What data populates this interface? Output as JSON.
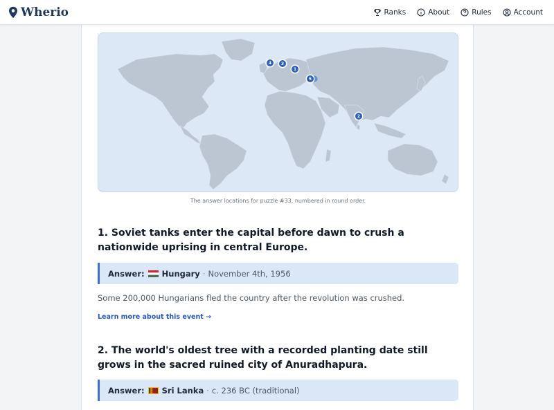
{
  "app": {
    "brand": "Wherio"
  },
  "nav": {
    "ranks": "Ranks",
    "about": "About",
    "rules": "Rules",
    "account": "Account"
  },
  "map": {
    "caption": "The answer locations for puzzle #33, numbered in round order.",
    "markers": [
      {
        "label": "4"
      },
      {
        "label": "3"
      },
      {
        "label": "1"
      },
      {
        "label": "5"
      },
      {
        "label": "2"
      }
    ]
  },
  "questions": [
    {
      "title": "1. Soviet tanks enter the capital before dawn to crush a nationwide uprising in central Europe.",
      "answer_label": "Answer:",
      "country": "Hungary",
      "separator": "·",
      "date": "November 4th, 1956",
      "fact": "Some 200,000 Hungarians fled the country after the revolution was crushed.",
      "link": "Learn more about this event →"
    },
    {
      "title": "2. The world's oldest tree with a recorded planting date still grows in the sacred ruined city of Anuradhapura.",
      "answer_label": "Answer:",
      "country": "Sri Lanka",
      "separator": "·",
      "date": "c. 236 BC (traditional)"
    }
  ],
  "colors": {
    "accent": "#2a5fbd",
    "answer_bg": "#dbe7f7",
    "map_ocean": "#dce8f6",
    "map_land": "#bcc6d2"
  }
}
